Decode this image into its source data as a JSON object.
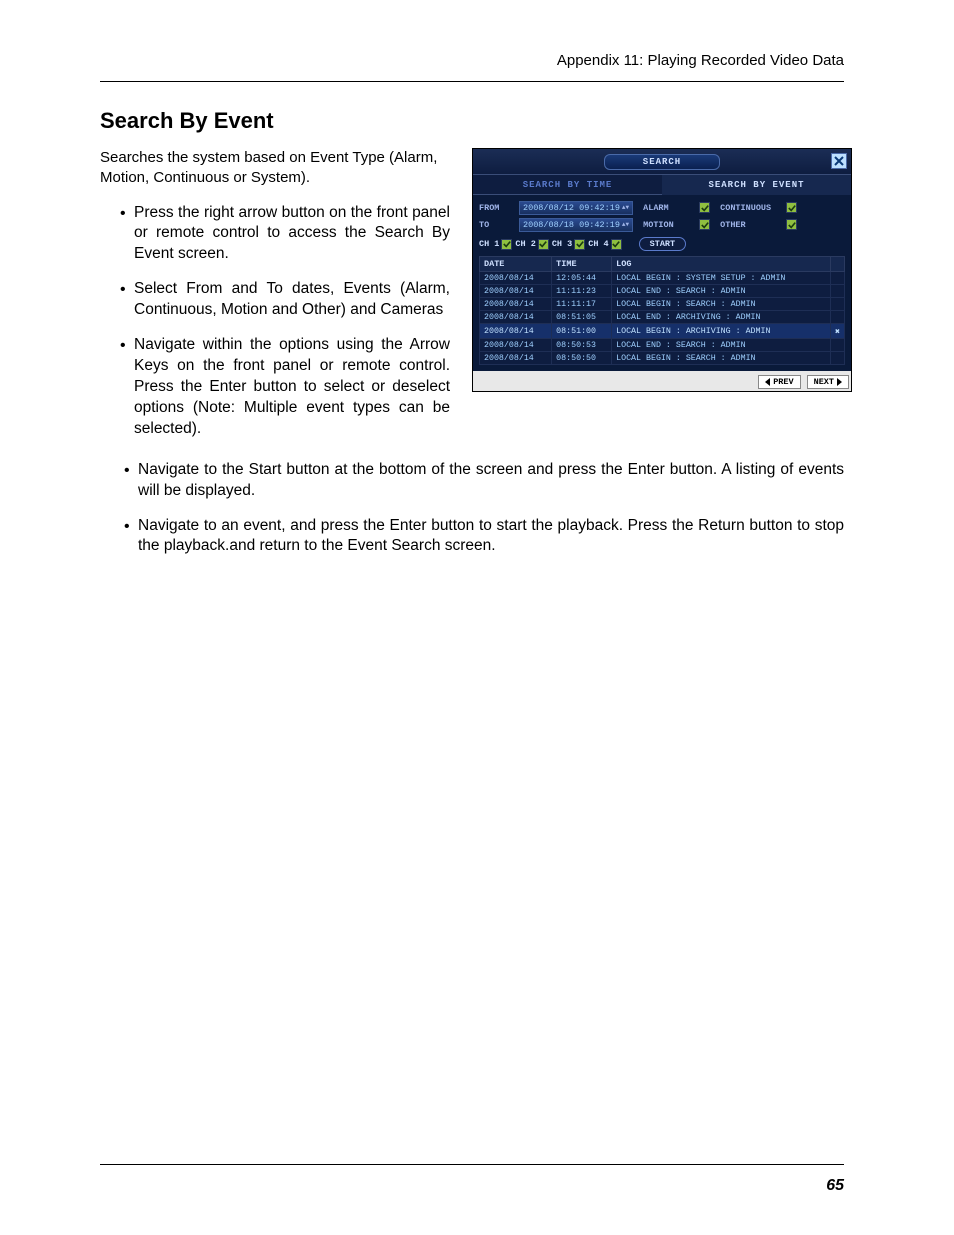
{
  "header": {
    "appendix": "Appendix 11: Playing Recorded Video Data"
  },
  "section": {
    "title": "Search By Event"
  },
  "intro": "Searches the system based on Event Type (Alarm, Motion, Continuous or System).",
  "bullets_left": [
    "Press the right arrow button on the front panel or remote control to access the Search By Event screen.",
    "Select From and To dates, Events (Alarm, Continuous, Motion and Other) and Cameras",
    "Navigate within the options using the Arrow Keys on the front panel or remote control. Press the Enter button to select or deselect options (Note: Multiple event types can be selected)."
  ],
  "bullets_full": [
    "Navigate to the Start button at the bottom of the screen and press the Enter button. A listing of events will be displayed.",
    "Navigate to an event, and press the Enter button to start the playback. Press the Return button to stop the playback.and return to the Event Search screen."
  ],
  "page_number": "65",
  "dvr": {
    "title": "SEARCH",
    "tabs": {
      "time": "SEARCH BY TIME",
      "event": "SEARCH BY EVENT"
    },
    "from_label": "FROM",
    "to_label": "TO",
    "from_value": "2008/08/12 09:42:19",
    "to_value": "2008/08/18 09:42:19",
    "events": {
      "alarm": "ALARM",
      "continuous": "CONTINUOUS",
      "motion": "MOTION",
      "other": "OTHER"
    },
    "channels": [
      "CH 1",
      "CH 2",
      "CH 3",
      "CH 4"
    ],
    "start": "START",
    "cols": {
      "date": "DATE",
      "time": "TIME",
      "log": "LOG"
    },
    "rows": [
      {
        "date": "2008/08/14",
        "time": "12:05:44",
        "log": "LOCAL BEGIN : SYSTEM SETUP : ADMIN"
      },
      {
        "date": "2008/08/14",
        "time": "11:11:23",
        "log": "LOCAL END : SEARCH : ADMIN"
      },
      {
        "date": "2008/08/14",
        "time": "11:11:17",
        "log": "LOCAL BEGIN : SEARCH : ADMIN"
      },
      {
        "date": "2008/08/14",
        "time": "08:51:05",
        "log": "LOCAL END : ARCHIVING : ADMIN"
      },
      {
        "date": "2008/08/14",
        "time": "08:51:00",
        "log": "LOCAL BEGIN : ARCHIVING : ADMIN",
        "selected": true
      },
      {
        "date": "2008/08/14",
        "time": "08:50:53",
        "log": "LOCAL END : SEARCH : ADMIN"
      },
      {
        "date": "2008/08/14",
        "time": "08:50:50",
        "log": "LOCAL BEGIN : SEARCH : ADMIN"
      }
    ],
    "prev": "PREV",
    "next": "NEXT"
  }
}
